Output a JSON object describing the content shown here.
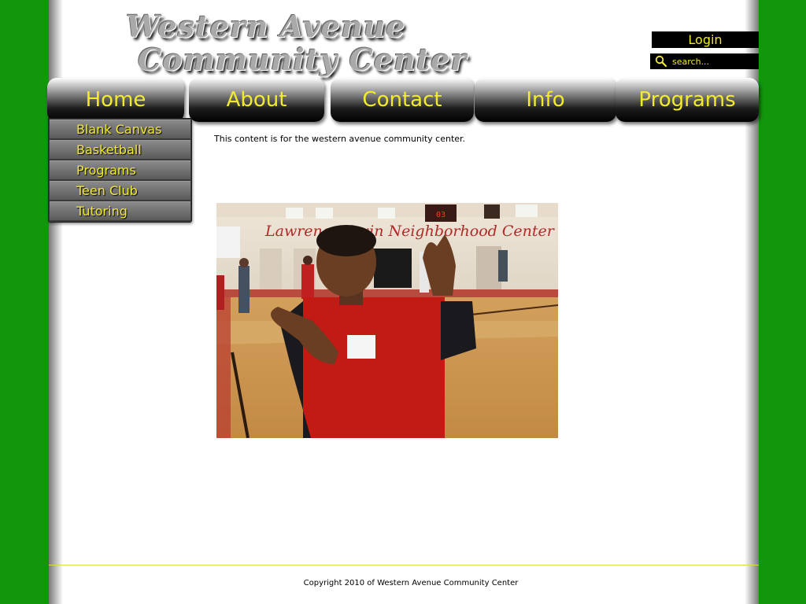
{
  "header": {
    "logo_line1": "Western Avenue",
    "logo_line2": "Community Center",
    "login_label": "Login",
    "search_placeholder": "search..."
  },
  "nav": {
    "tabs": [
      {
        "label": "Home"
      },
      {
        "label": "About"
      },
      {
        "label": "Contact"
      },
      {
        "label": "Info"
      },
      {
        "label": "Programs"
      }
    ]
  },
  "sidebar": {
    "items": [
      {
        "label": "Blank Canvas"
      },
      {
        "label": "Basketball"
      },
      {
        "label": "Programs"
      },
      {
        "label": "Teen Club"
      },
      {
        "label": "Tutoring"
      }
    ]
  },
  "main": {
    "text": "This content is for the western avenue community center.",
    "photo_banner_text": "Lawrence Gwin Neighborhood Center",
    "photo_scoreboard": "03"
  },
  "footer": {
    "copyright": "Copyright 2010 of Western Avenue Community Center"
  },
  "colors": {
    "background_green": "#12960c",
    "accent_yellow": "#f2ea2c"
  }
}
